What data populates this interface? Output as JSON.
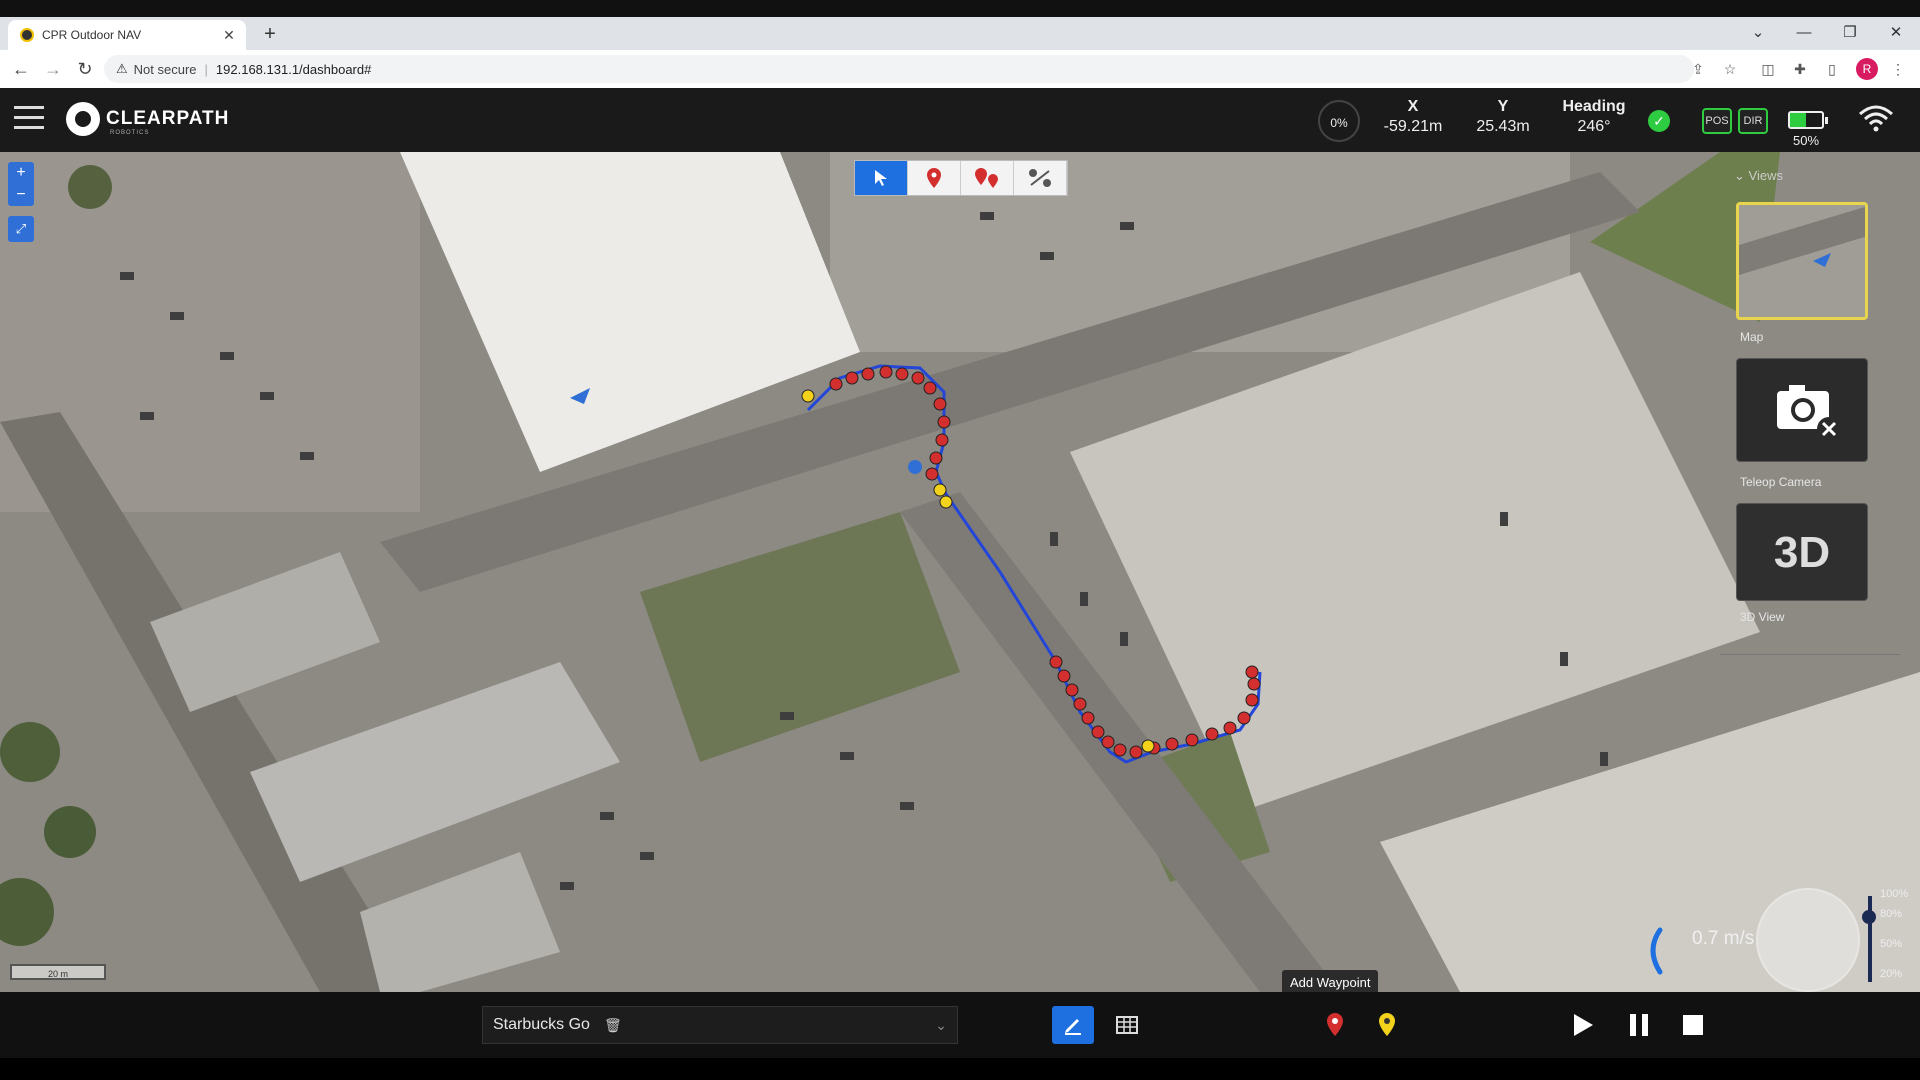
{
  "browser": {
    "tab_title": "CPR Outdoor NAV",
    "tab_close": "✕",
    "new_tab": "+",
    "not_secure": "Not secure",
    "url": "192.168.131.1/dashboard#",
    "profile_initial": "R"
  },
  "header": {
    "brand": "CLEARPATH",
    "brand_sub": "ROBOTICS",
    "progress": "0%",
    "x_label": "X",
    "x_value": "-59.21m",
    "y_label": "Y",
    "y_value": "25.43m",
    "heading_label": "Heading",
    "heading_value": "246°",
    "pos_label": "POS",
    "dir_label": "DIR",
    "battery_percent": "50%",
    "battery_level": 0.5
  },
  "map": {
    "zoom_in": "+",
    "zoom_out": "−",
    "scale_label": "20 m",
    "views_title": "Views",
    "view_map_label": "Map",
    "view_camera_label": "Teleop Camera",
    "view_3d_label": "3D View",
    "view_3d_text": "3D",
    "speed": "0.7 m/s",
    "speed_ticks": [
      "100%",
      "80%",
      "50%",
      "20%"
    ],
    "tooltip": "Add Waypoint"
  },
  "mission": {
    "name": "Starbucks Go"
  },
  "colors": {
    "accent": "#1e6fe0",
    "status_ok": "#2ecc40",
    "waypoint": "#d32f2f",
    "waypoint_yellow": "#f2d21b",
    "path": "#2346d8"
  }
}
